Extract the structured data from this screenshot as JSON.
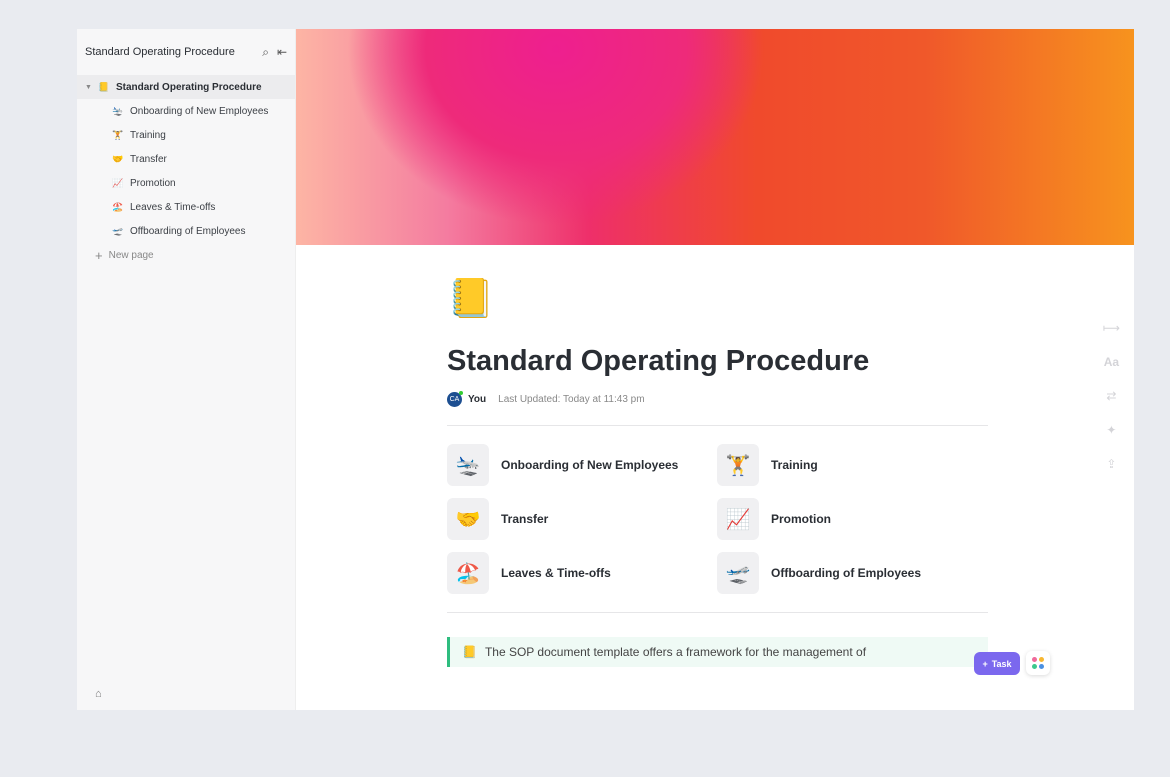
{
  "sidebar": {
    "title": "Standard Operating Procedure",
    "root": "Standard Operating Procedure",
    "root_emoji": "📒",
    "items": [
      {
        "emoji": "🛬",
        "label": "Onboarding of New Employees"
      },
      {
        "emoji": "🏋️",
        "label": "Training"
      },
      {
        "emoji": "🤝",
        "label": "Transfer"
      },
      {
        "emoji": "📈",
        "label": "Promotion"
      },
      {
        "emoji": "🏖️",
        "label": "Leaves & Time-offs"
      },
      {
        "emoji": "🛫",
        "label": "Offboarding of Employees"
      }
    ],
    "new_page": "New page"
  },
  "page": {
    "icon": "📒",
    "title": "Standard Operating Procedure",
    "avatar": "CA",
    "author": "You",
    "updated": "Last Updated: Today at 11:43 pm",
    "cards": [
      {
        "emoji": "🛬",
        "label": "Onboarding of New Employees"
      },
      {
        "emoji": "🏋️",
        "label": "Training"
      },
      {
        "emoji": "🤝",
        "label": "Transfer"
      },
      {
        "emoji": "📈",
        "label": "Promotion"
      },
      {
        "emoji": "🏖️",
        "label": "Leaves & Time-offs"
      },
      {
        "emoji": "🛫",
        "label": "Offboarding of Employees"
      }
    ],
    "callout_emoji": "📒",
    "callout": "The SOP document template offers a framework for the management of"
  },
  "fab": {
    "task": "Task",
    "plus": "+"
  },
  "tools": {
    "font": "Aa"
  }
}
